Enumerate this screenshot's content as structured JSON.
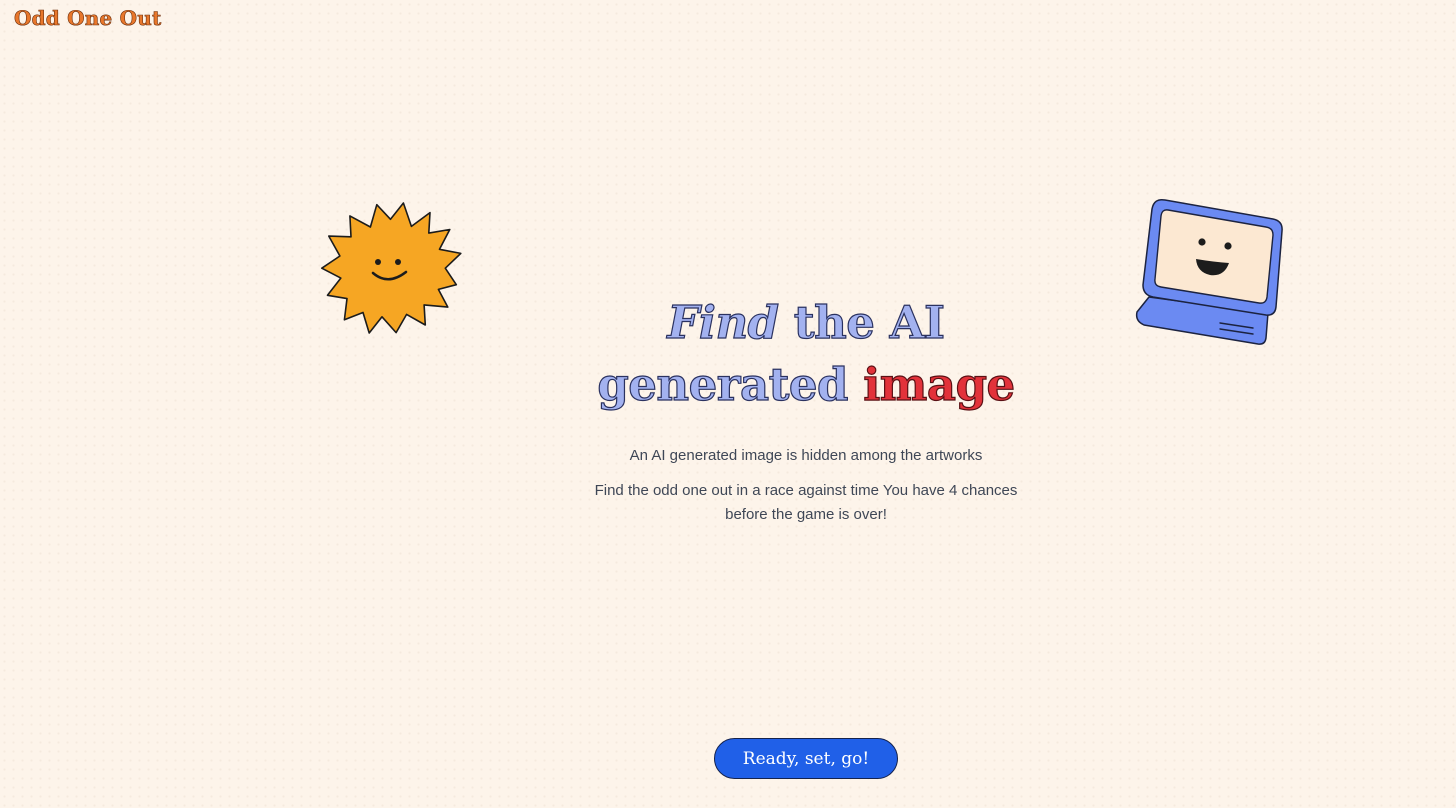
{
  "app": {
    "logo": "Odd One Out"
  },
  "hero": {
    "title_word_1": "Find",
    "title_word_2": " the AI",
    "title_word_3": "generated",
    "title_word_4": "image",
    "subtitle_1": "An AI generated image is hidden among the artworks",
    "subtitle_2": "Find the odd one out in a race against time You have 4 chances before the game is over!"
  },
  "actions": {
    "start_label": "Ready, set, go!"
  },
  "illustrations": {
    "left": "smiling-sun-icon",
    "right": "smiling-computer-icon"
  },
  "colors": {
    "background": "#fdf4ea",
    "logo": "#e8772b",
    "title_blue": "#a3b2f0",
    "title_red": "#e2323a",
    "button": "#2060e8",
    "sun": "#f6a623",
    "computer": "#6b8af2"
  }
}
